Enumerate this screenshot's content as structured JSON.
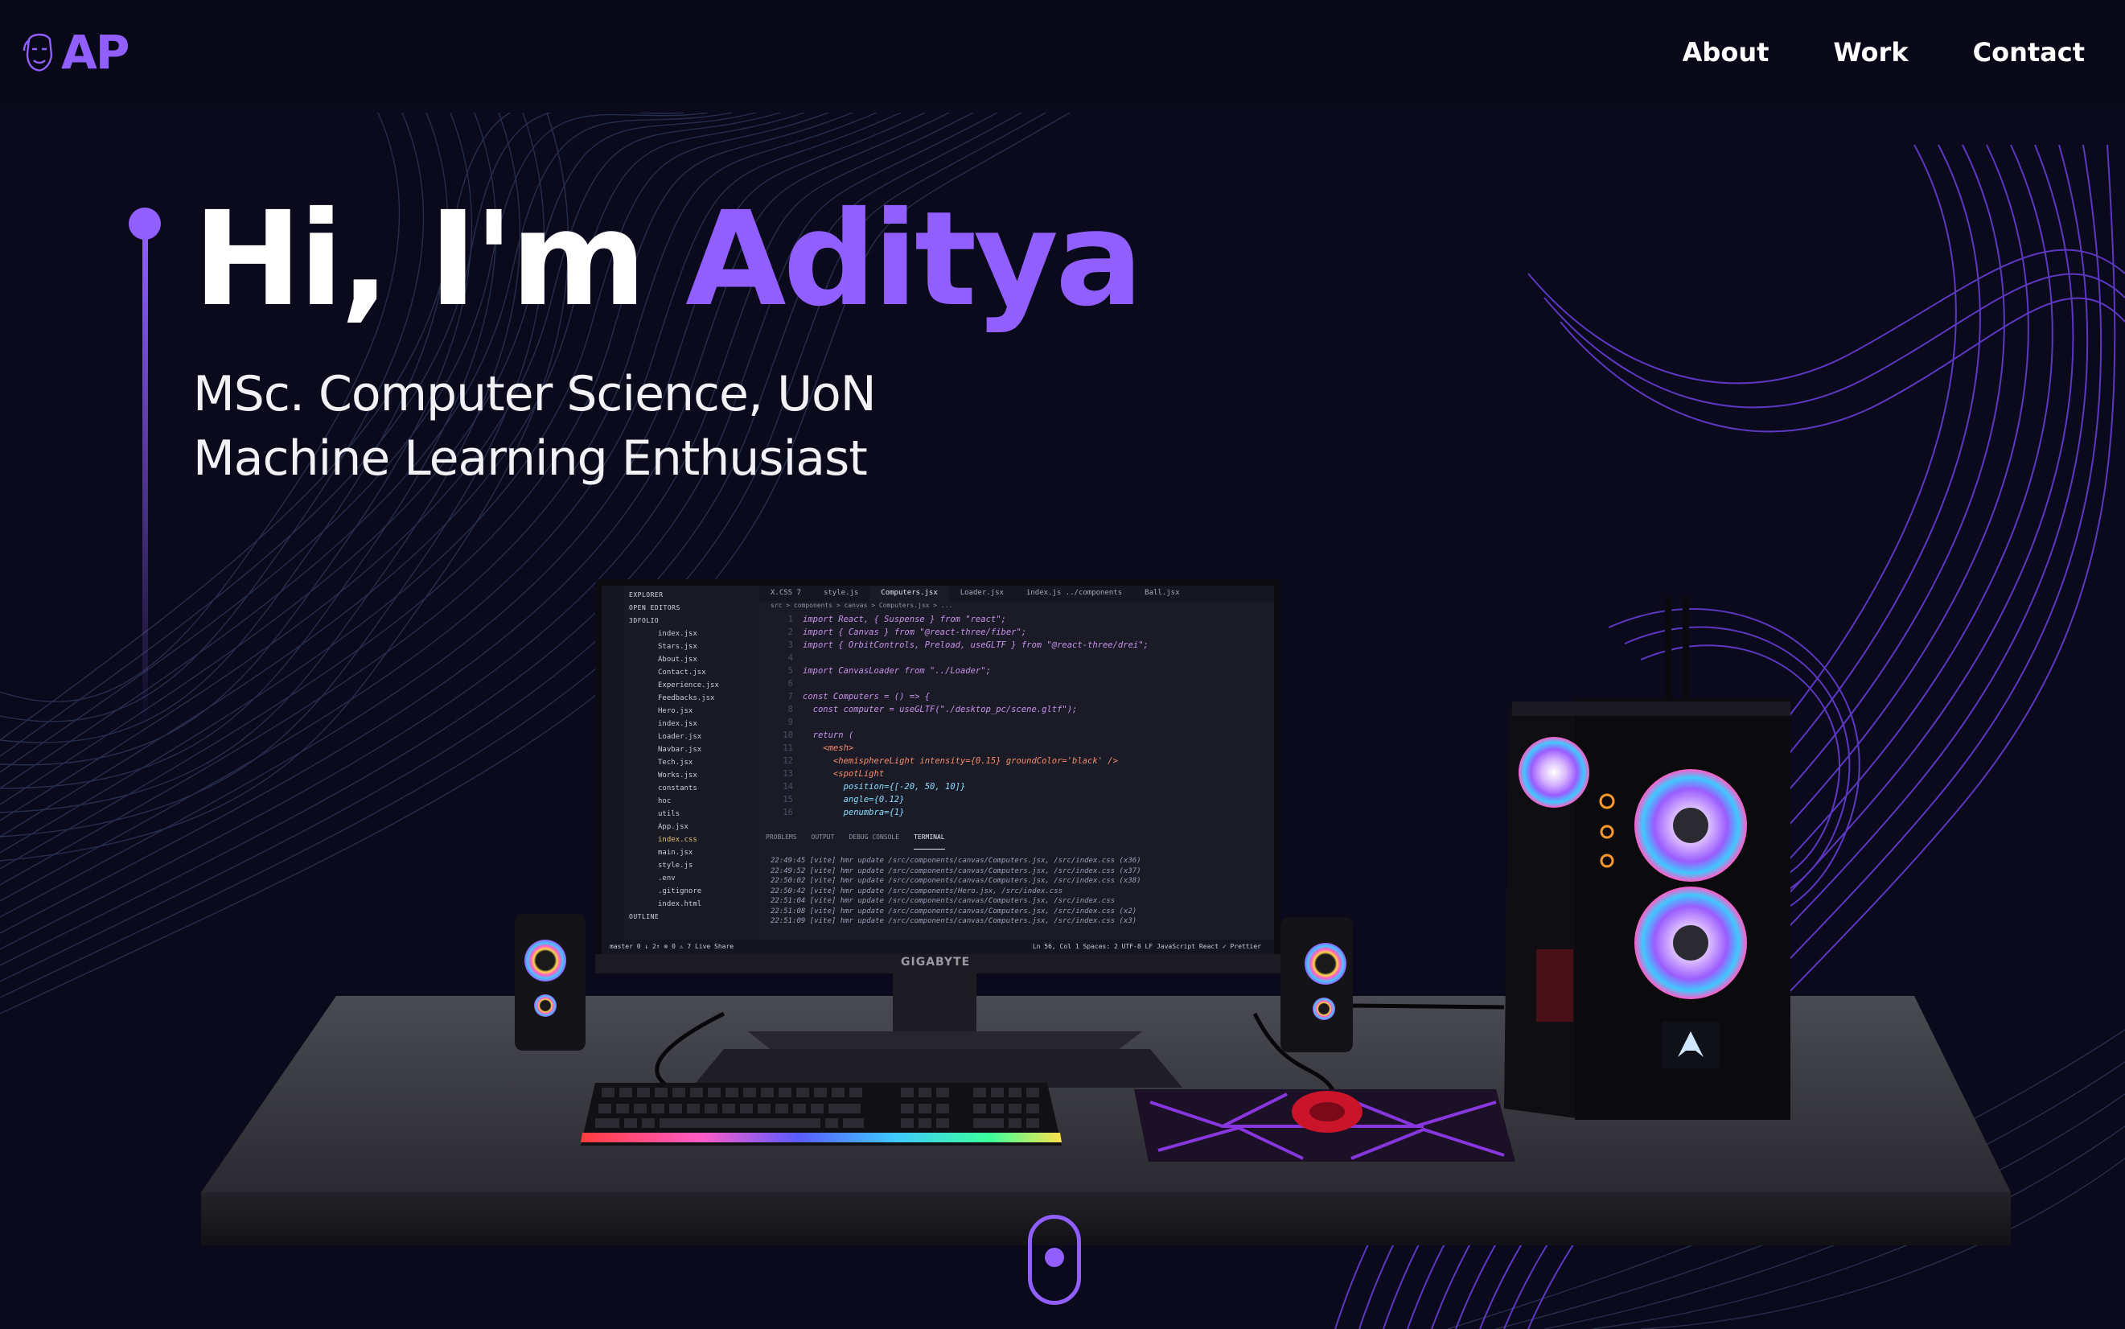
{
  "navbar": {
    "logo_text": "AP",
    "logo_icon": "face-sketch-icon",
    "links": [
      {
        "label": "About"
      },
      {
        "label": "Work"
      },
      {
        "label": "Contact"
      }
    ]
  },
  "hero": {
    "greeting": "Hi, I'm ",
    "name": "Aditya",
    "subtitle_line1": "MSc. Computer Science, UoN",
    "subtitle_line2": "Machine Learning Enthusiast"
  },
  "scene": {
    "monitor_brand": "GIGABYTE",
    "editor": {
      "explorer_header": "EXPLORER",
      "open_editors": "OPEN EDITORS",
      "project": "3DFOLIO",
      "files": [
        "index.jsx",
        "Stars.jsx",
        "About.jsx",
        "Contact.jsx",
        "Experience.jsx",
        "Feedbacks.jsx",
        "Hero.jsx",
        "index.jsx",
        "Loader.jsx",
        "Navbar.jsx",
        "Tech.jsx",
        "Works.jsx",
        "constants",
        "hoc",
        "utils",
        "App.jsx",
        "index.css",
        "main.jsx",
        "style.js",
        ".env",
        ".gitignore",
        "index.html"
      ],
      "outline": "OUTLINE",
      "tabs": [
        "X.CSS 7",
        "style.js",
        "Computers.jsx",
        "Loader.jsx",
        "index.js ../components",
        "Ball.jsx"
      ],
      "breadcrumb": "src > components > canvas > Computers.jsx > ...",
      "code_lines": [
        {
          "n": "1",
          "t": "import React, { Suspense } from \"react\";"
        },
        {
          "n": "2",
          "t": "import { Canvas } from \"@react-three/fiber\";"
        },
        {
          "n": "3",
          "t": "import { OrbitControls, Preload, useGLTF } from \"@react-three/drei\";"
        },
        {
          "n": "4",
          "t": ""
        },
        {
          "n": "5",
          "t": "import CanvasLoader from \"../Loader\";"
        },
        {
          "n": "6",
          "t": ""
        },
        {
          "n": "7",
          "t": "const Computers = () => {"
        },
        {
          "n": "8",
          "t": "  const computer = useGLTF(\"./desktop_pc/scene.gltf\");"
        },
        {
          "n": "9",
          "t": ""
        },
        {
          "n": "10",
          "t": "  return ("
        },
        {
          "n": "11",
          "t": "    <mesh>"
        },
        {
          "n": "12",
          "t": "      <hemisphereLight intensity={0.15} groundColor='black' />"
        },
        {
          "n": "13",
          "t": "      <spotLight"
        },
        {
          "n": "14",
          "t": "        position={[-20, 50, 10]}"
        },
        {
          "n": "15",
          "t": "        angle={0.12}"
        },
        {
          "n": "16",
          "t": "        penumbra={1}"
        }
      ],
      "panel_tabs": [
        "PROBLEMS",
        "OUTPUT",
        "DEBUG CONSOLE",
        "TERMINAL"
      ],
      "terminal_lines": [
        "22:49:45 [vite] hmr update /src/components/canvas/Computers.jsx, /src/index.css (x36)",
        "22:49:52 [vite] hmr update /src/components/canvas/Computers.jsx, /src/index.css (x37)",
        "22:50:02 [vite] hmr update /src/components/canvas/Computers.jsx, /src/index.css (x38)",
        "22:50:42 [vite] hmr update /src/components/Hero.jsx, /src/index.css",
        "22:51:04 [vite] hmr update /src/components/canvas/Computers.jsx, /src/index.css",
        "22:51:08 [vite] hmr update /src/components/canvas/Computers.jsx, /src/index.css (x2)",
        "22:51:09 [vite] hmr update /src/components/canvas/Computers.jsx, /src/index.css (x3)"
      ],
      "status_left": "master   0 ↓ 2↑   ⊗ 0 ⚠ 7   Live Share",
      "status_right": "Ln 56, Col 1   Spaces: 2   UTF-8   LF   JavaScript React   ✓ Prettier"
    }
  },
  "colors": {
    "accent": "#915eff",
    "background": "#0a0a1c",
    "text": "#ffffff"
  },
  "scroll_indicator_icon": "mouse-scroll-icon"
}
